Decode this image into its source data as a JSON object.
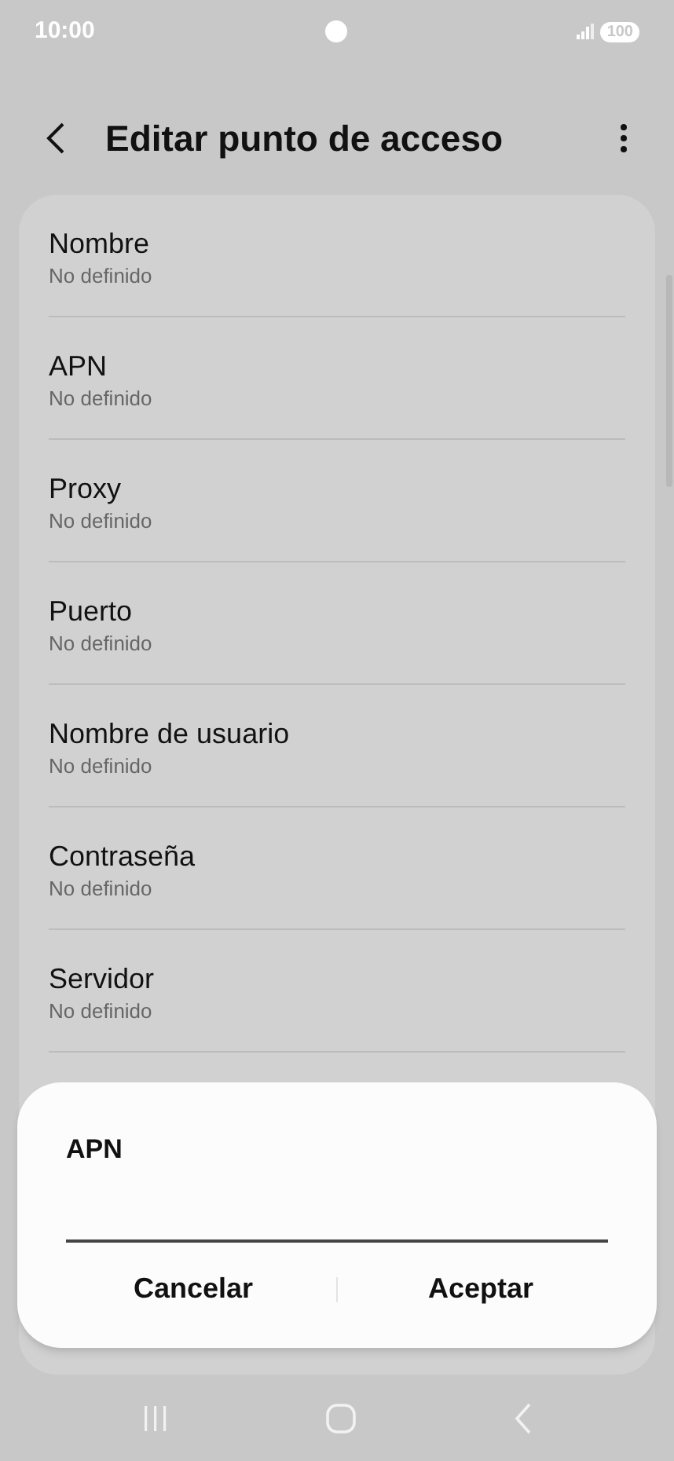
{
  "status_bar": {
    "time": "10:00",
    "battery": "100"
  },
  "header": {
    "title": "Editar punto de acceso"
  },
  "settings": [
    {
      "label": "Nombre",
      "value": "No definido"
    },
    {
      "label": "APN",
      "value": "No definido"
    },
    {
      "label": "Proxy",
      "value": "No definido"
    },
    {
      "label": "Puerto",
      "value": "No definido"
    },
    {
      "label": "Nombre de usuario",
      "value": "No definido"
    },
    {
      "label": "Contraseña",
      "value": "No definido"
    },
    {
      "label": "Servidor",
      "value": "No definido"
    }
  ],
  "dialog": {
    "title": "APN",
    "buttons": [
      "Cancelar",
      "Aceptar"
    ]
  }
}
